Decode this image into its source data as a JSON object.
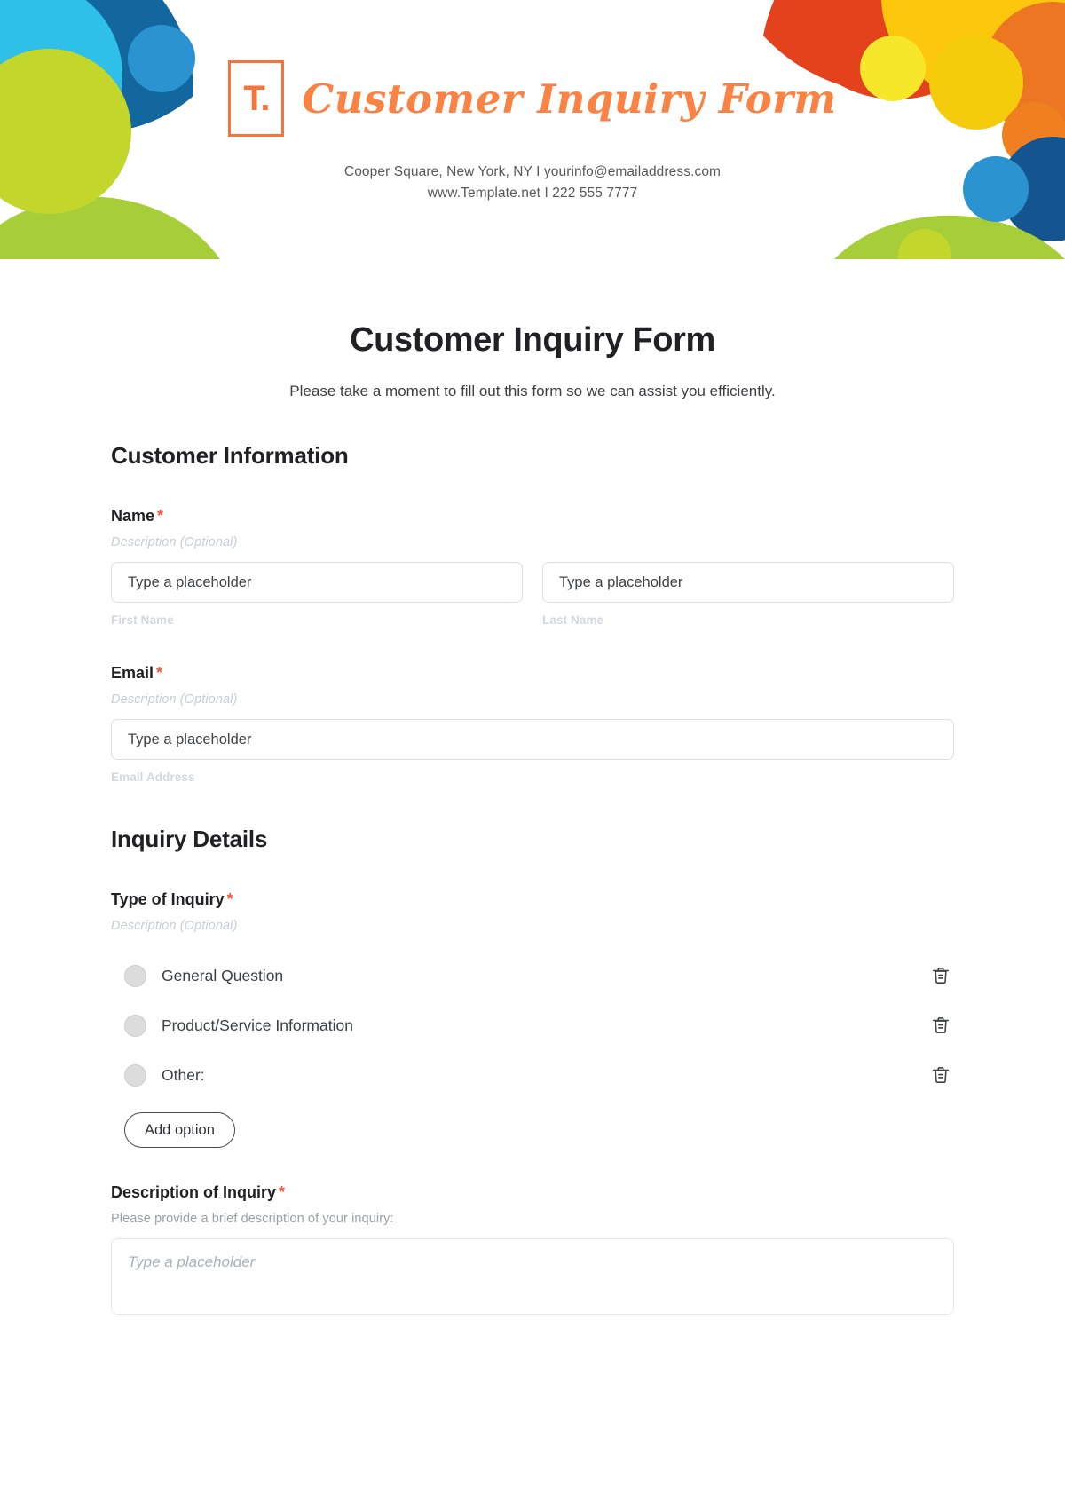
{
  "banner": {
    "logo_glyph": "T.",
    "brand_title": "Customer Inquiry Form",
    "contact_line_1": "Cooper Square, New York, NY  I  yourinfo@emailaddress.com",
    "contact_line_2": "www.Template.net  I  222 555 7777",
    "colors": {
      "orange_accent": "#fa8243",
      "logo_border": "#f5743b",
      "deep_blue": "#12679f",
      "sky_blue": "#2ec0e8",
      "mid_blue": "#2b93cf",
      "navy": "#14558f",
      "lime": "#c3d62b",
      "green": "#a6ce39",
      "red": "#e4411d",
      "yellow": "#fdc70d",
      "bright_yellow": "#f6e72a",
      "gold": "#f5cc0c",
      "orange": "#ef7f1f",
      "orange_dark": "#ec7622"
    }
  },
  "form": {
    "title": "Customer Inquiry Form",
    "subtitle": "Please take a moment to fill out this form so we can assist you efficiently.",
    "required_marker": "*",
    "sections": [
      {
        "heading": "Customer Information",
        "fields": [
          {
            "label": "Name",
            "description": "Description (Optional)",
            "inputs": [
              {
                "placeholder": "Type a placeholder",
                "sub_label": "First Name"
              },
              {
                "placeholder": "Type a placeholder",
                "sub_label": "Last Name"
              }
            ]
          },
          {
            "label": "Email",
            "description": "Description (Optional)",
            "inputs": [
              {
                "placeholder": "Type a placeholder",
                "sub_label": "Email Address"
              }
            ]
          }
        ]
      },
      {
        "heading": "Inquiry Details",
        "fields": [
          {
            "label": "Type of Inquiry",
            "description": "Description (Optional)",
            "options": [
              {
                "label": "General Question",
                "delete_icon": "trash-icon"
              },
              {
                "label": "Product/Service Information",
                "delete_icon": "trash-icon"
              },
              {
                "label": "Other:",
                "delete_icon": "trash-icon"
              }
            ],
            "add_option_label": "Add option"
          },
          {
            "label": "Description of Inquiry",
            "description": "Please provide a brief description of your inquiry:",
            "textarea_placeholder": "Type a placeholder"
          }
        ]
      }
    ]
  }
}
